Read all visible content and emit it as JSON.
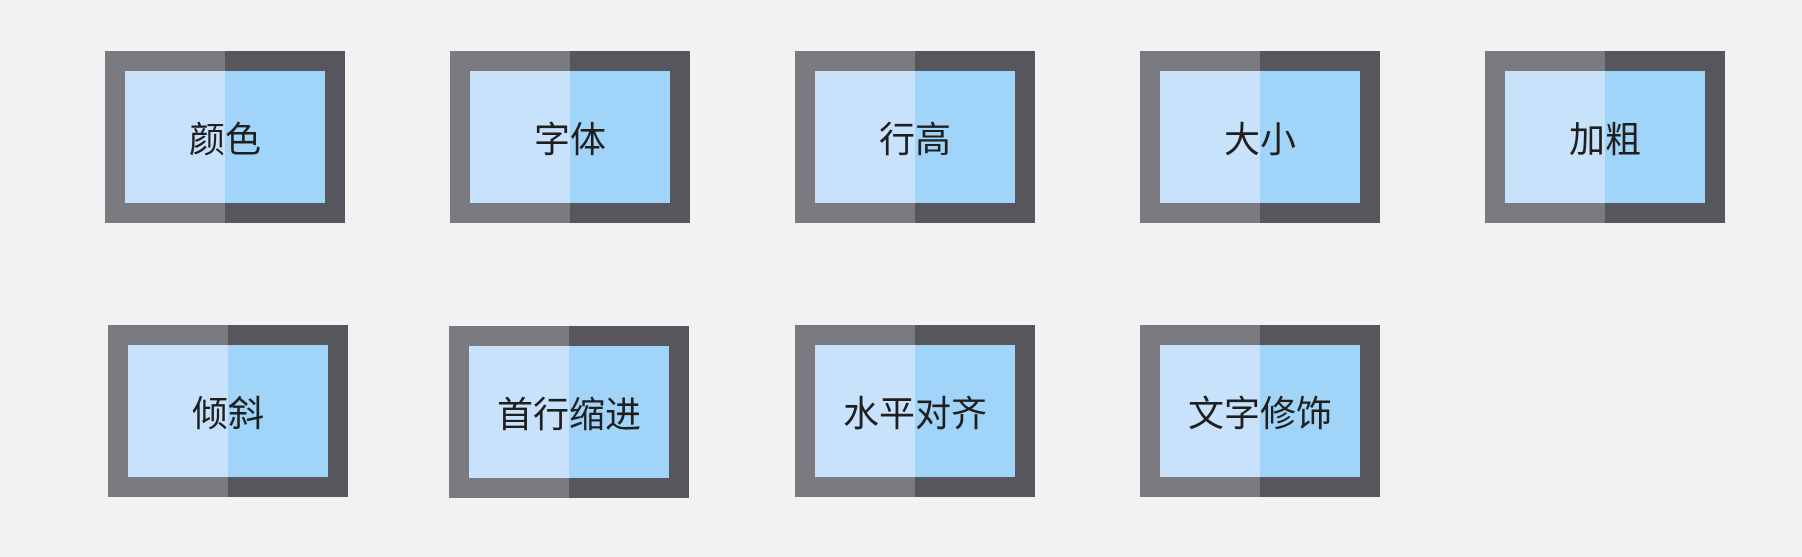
{
  "tiles": [
    {
      "label": "颜色"
    },
    {
      "label": "字体"
    },
    {
      "label": "行高"
    },
    {
      "label": "大小"
    },
    {
      "label": "加粗"
    },
    {
      "label": "倾斜"
    },
    {
      "label": "首行缩进"
    },
    {
      "label": "水平对齐"
    },
    {
      "label": "文字修饰"
    }
  ],
  "colors": {
    "background": "#f2f2f3",
    "frame_light": "#7b7a80",
    "frame_dark": "#58565d",
    "screen_light": "#c9e2fb",
    "screen_dark": "#a0d4f8",
    "text": "#1f1f1f"
  }
}
